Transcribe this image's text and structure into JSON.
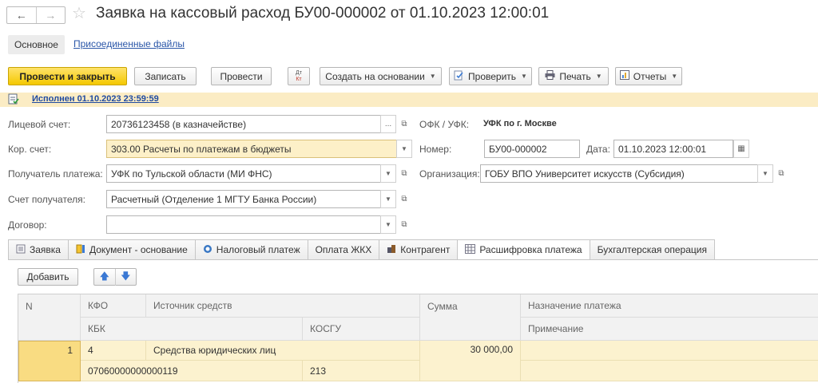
{
  "window": {
    "title": "Заявка на кассовый расход БУ00-000002 от 01.10.2023 12:00:01",
    "back_glyph": "←",
    "forward_glyph": "→",
    "star_glyph": "☆"
  },
  "sections": {
    "main": "Основное",
    "files": "Присоединенные файлы"
  },
  "toolbar": {
    "post_close": "Провести и закрыть",
    "save": "Записать",
    "post": "Провести",
    "dt_kt_top": "Дт",
    "dt_kt_bottom": "Кт",
    "create_based": "Создать на основании",
    "check": "Проверить",
    "print": "Печать",
    "reports": "Отчеты",
    "dropdown_glyph": "▼"
  },
  "status": {
    "text": "Исполнен 01.10.2023 23:59:59"
  },
  "form": {
    "personal_account_label": "Лицевой счет:",
    "personal_account_value": "20736123458 (в казначействе)",
    "ofk_label": "ОФК / УФК:",
    "ofk_value": "УФК по г. Москве",
    "kor_account_label": "Кор. счет:",
    "kor_account_value": "303.00 Расчеты по платежам в бюджеты",
    "number_label": "Номер:",
    "number_value": "БУ00-000002",
    "date_label": "Дата:",
    "date_value": "01.10.2023 12:00:01",
    "recipient_label": "Получатель платежа:",
    "recipient_value": "УФК по Тульской области (МИ ФНС)",
    "org_label": "Организация:",
    "org_value": "ГОБУ ВПО Университет искусств (Субсидия)",
    "recipient_account_label": "Счет получателя:",
    "recipient_account_value": "Расчетный (Отделение 1 МГТУ Банка России)",
    "contract_label": "Договор:",
    "contract_value": "",
    "ellipsis": "...",
    "open_glyph": "⧉",
    "select_glyph": "▼",
    "calendar_glyph": "▦"
  },
  "tabs": [
    {
      "label": "Заявка"
    },
    {
      "label": "Документ - основание"
    },
    {
      "label": "Налоговый платеж"
    },
    {
      "label": "Оплата ЖКХ"
    },
    {
      "label": "Контрагент"
    },
    {
      "label": "Расшифровка платежа"
    },
    {
      "label": "Бухгалтерская операция"
    }
  ],
  "table_toolbar": {
    "add": "Добавить",
    "up_glyph": "🡅",
    "down_glyph": "🡇"
  },
  "table": {
    "headers": {
      "n": "N",
      "kfo": "КФО",
      "source": "Источник средств",
      "sum": "Сумма",
      "purpose": "Назначение платежа",
      "kbk": "КБК",
      "kosgu": "КОСГУ",
      "note": "Примечание"
    },
    "rows": [
      {
        "n": "1",
        "kfo": "4",
        "source": "Средства юридических лиц",
        "sum": "30 000,00",
        "purpose": "",
        "kbk": "07060000000000119",
        "kosgu": "213",
        "note": ""
      }
    ]
  }
}
